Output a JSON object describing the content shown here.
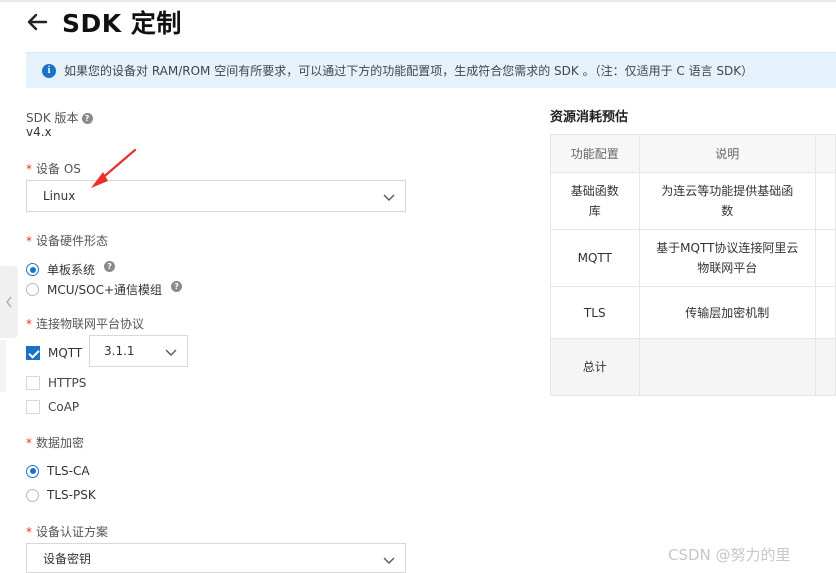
{
  "header": {
    "back_icon": "arrow-left-icon",
    "title": "SDK 定制"
  },
  "notice": {
    "icon": "info-icon",
    "text": "如果您的设备对 RAM/ROM 空间有所要求，可以通过下方的功能配置项，生成符合您需求的 SDK 。（注：仅适用于 C 语言 SDK）"
  },
  "form": {
    "sdk_version": {
      "label": "SDK 版本",
      "value": "v4.x"
    },
    "device_os": {
      "label": "设备 OS",
      "value": "Linux"
    },
    "hardware": {
      "label": "设备硬件形态",
      "options": [
        {
          "label": "单板系统",
          "selected": true
        },
        {
          "label": "MCU/SOC+通信模组",
          "selected": false
        }
      ]
    },
    "protocol": {
      "label": "连接物联网平台协议",
      "options": [
        {
          "label": "MQTT",
          "checked": true
        },
        {
          "label": "HTTPS",
          "checked": false
        },
        {
          "label": "CoAP",
          "checked": false
        }
      ],
      "mqtt_version": "3.1.1"
    },
    "encryption": {
      "label": "数据加密",
      "options": [
        {
          "label": "TLS-CA",
          "selected": true
        },
        {
          "label": "TLS-PSK",
          "selected": false
        }
      ]
    },
    "auth": {
      "label": "设备认证方案",
      "value": "设备密钥"
    }
  },
  "resources": {
    "title": "资源消耗预估",
    "headers": [
      "功能配置",
      "说明"
    ],
    "rows": [
      {
        "feature": "基础函数库",
        "desc": "为连云等功能提供基础函数"
      },
      {
        "feature": "MQTT",
        "desc": "基于MQTT协议连接阿里云物联网平台"
      },
      {
        "feature": "TLS",
        "desc": "传输层加密机制"
      }
    ],
    "total_label": "总计"
  },
  "watermark": "CSDN @努力的里",
  "colors": {
    "accent": "#1a73c8",
    "required": "#e5372a",
    "annotation": "#e8312a",
    "notice_bg": "#e6f2fb"
  }
}
